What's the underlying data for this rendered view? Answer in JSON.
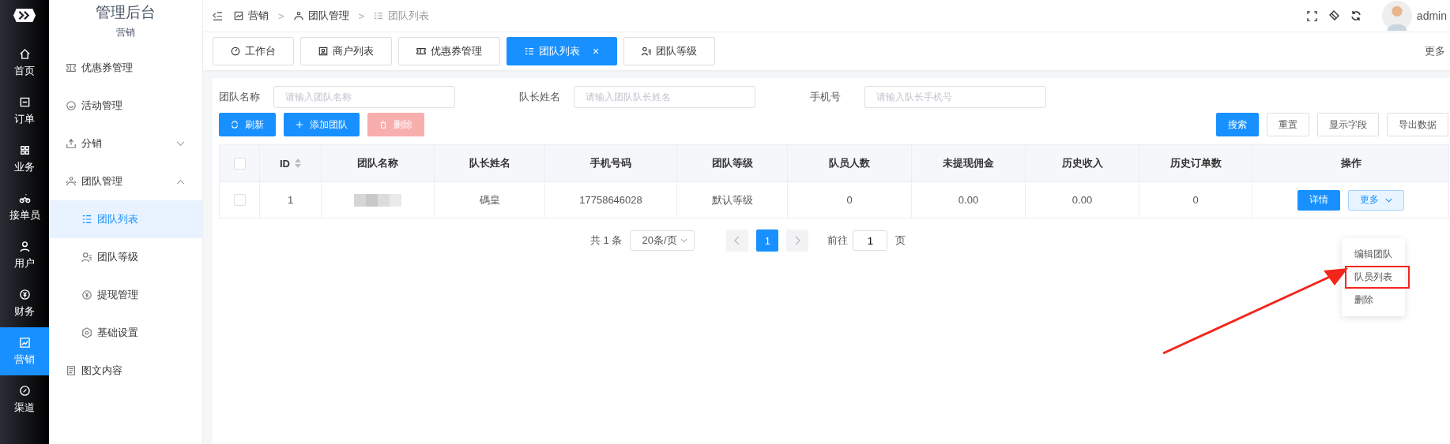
{
  "rail": [
    {
      "label": "首页",
      "selected": false
    },
    {
      "label": "订单",
      "selected": false
    },
    {
      "label": "业务",
      "selected": false
    },
    {
      "label": "接单员",
      "selected": false
    },
    {
      "label": "用户",
      "selected": false
    },
    {
      "label": "财务",
      "selected": false
    },
    {
      "label": "营销",
      "selected": true
    },
    {
      "label": "渠道",
      "selected": false
    }
  ],
  "sidebar": {
    "title": "管理后台",
    "section": "营销",
    "items": [
      {
        "label": "优惠券管理",
        "selected": false
      },
      {
        "label": "活动管理",
        "selected": false
      },
      {
        "label": "分销",
        "selected": false,
        "expanded": false
      },
      {
        "label": "团队管理",
        "selected": false,
        "expanded": true,
        "children": [
          {
            "label": "团队列表",
            "selected": true
          },
          {
            "label": "团队等级",
            "selected": false
          },
          {
            "label": "提现管理",
            "selected": false
          },
          {
            "label": "基础设置",
            "selected": false
          }
        ]
      },
      {
        "label": "图文内容",
        "selected": false
      }
    ]
  },
  "breadcrumb": [
    "营销",
    "团队管理",
    "团队列表"
  ],
  "breadcrumb_separators": [
    ">",
    ">"
  ],
  "user": {
    "name": "admin"
  },
  "tabs": [
    {
      "label": "工作台",
      "selected": false,
      "closable": false
    },
    {
      "label": "商户列表",
      "selected": false,
      "closable": false
    },
    {
      "label": "优惠券管理",
      "selected": false,
      "closable": false
    },
    {
      "label": "团队列表",
      "selected": true,
      "closable": true
    },
    {
      "label": "团队等级",
      "selected": false,
      "closable": false
    }
  ],
  "tabs_more": "更多",
  "close_glyph": "×",
  "filters": [
    {
      "label": "团队名称",
      "placeholder": "请输入团队名称"
    },
    {
      "label": "队长姓名",
      "placeholder": "请输入团队队长姓名"
    },
    {
      "label": "手机号",
      "placeholder": "请输入队长手机号"
    }
  ],
  "left_buttons": [
    {
      "label": "刷新",
      "kind": "refresh",
      "disabled": false
    },
    {
      "label": "添加团队",
      "kind": "add",
      "disabled": false
    },
    {
      "label": "删除",
      "kind": "delete",
      "disabled": true
    }
  ],
  "right_buttons": [
    {
      "label": "搜索",
      "kind": "primary"
    },
    {
      "label": "重置",
      "kind": "plain"
    },
    {
      "label": "显示字段",
      "kind": "plain"
    },
    {
      "label": "导出数据",
      "kind": "plain"
    }
  ],
  "table": {
    "select_all_checked": false,
    "columns": [
      "ID",
      "团队名称",
      "队长姓名",
      "手机号码",
      "团队等级",
      "队员人数",
      "未提现佣金",
      "历史收入",
      "历史订单数",
      "操作"
    ],
    "rows": [
      {
        "checked": false,
        "cells": [
          "1",
          "",
          "碼皇",
          "17758646028",
          "默认等级",
          "0",
          "0.00",
          "0.00",
          "0"
        ],
        "actions": [
          "详情",
          "更多"
        ]
      }
    ]
  },
  "pagination": {
    "total": "共 1 条",
    "page_size": "20条/页",
    "pages": [
      {
        "label": "1",
        "selected": true
      }
    ],
    "goto_label": "前往",
    "goto_value": "1",
    "goto_unit": "页"
  },
  "dropdown": [
    {
      "label": "编辑团队",
      "highlighted": false
    },
    {
      "label": "队员列表",
      "highlighted": true
    },
    {
      "label": "删除",
      "highlighted": false
    }
  ]
}
